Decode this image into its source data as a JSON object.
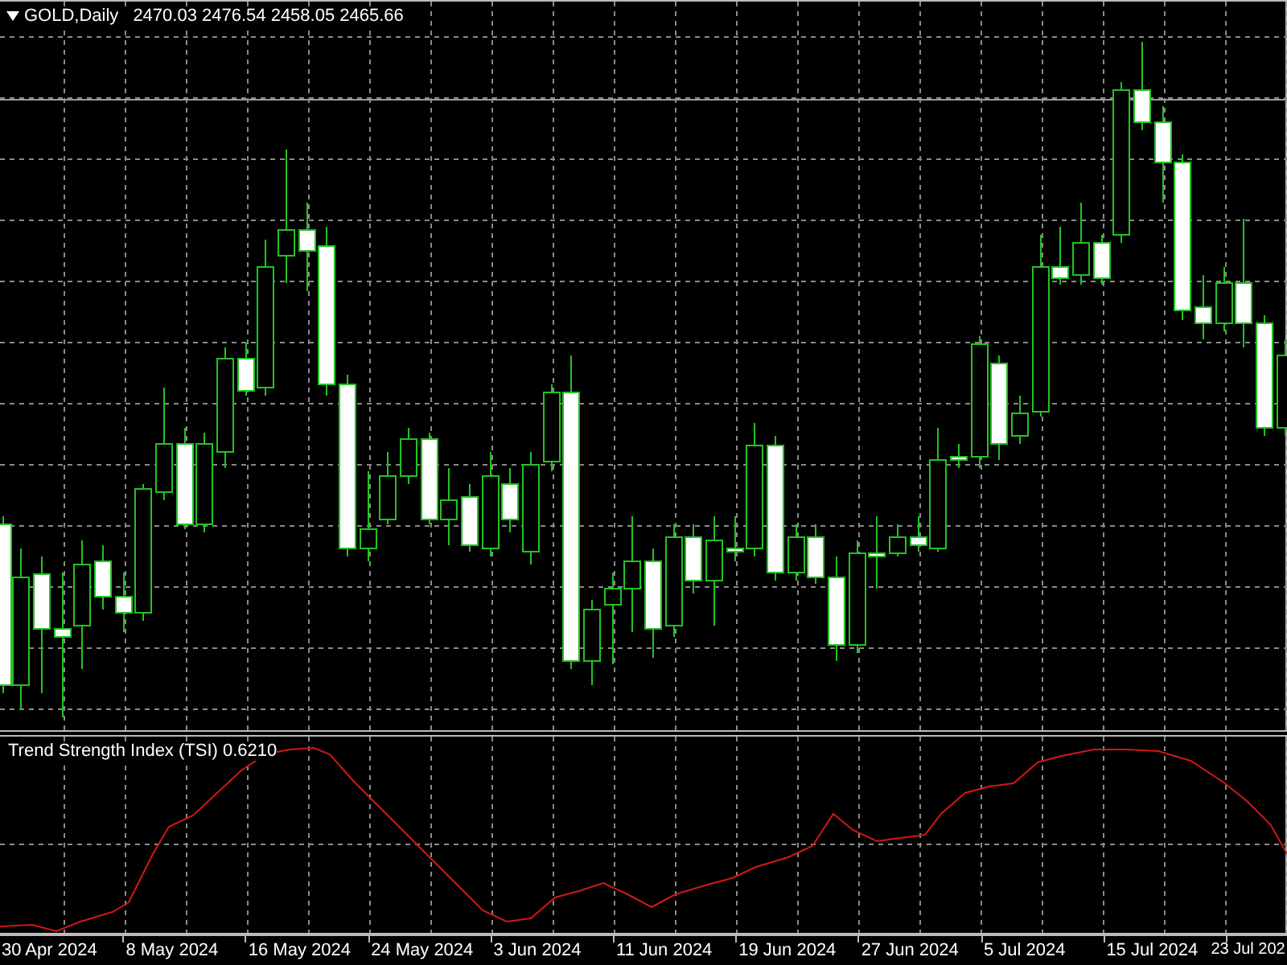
{
  "chart": {
    "symbol": "GOLD,Daily",
    "ohlc": "2470.03 2476.54 2458.05 2465.66"
  },
  "indicator": {
    "label": "Trend Strength Index (TSI) 0.6210"
  },
  "time_axis": [
    "30 Apr 2024",
    "8 May 2024",
    "16 May 2024",
    "24 May 2024",
    "3 Jun 2024",
    "11 Jun 2024",
    "19 Jun 2024",
    "27 Jun 2024",
    "5 Jul 2024",
    "15 Jul 2024",
    "23 Jul 202"
  ]
}
